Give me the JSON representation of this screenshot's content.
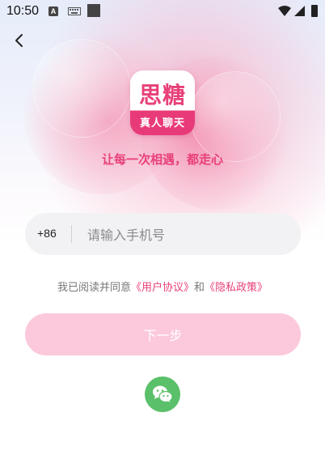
{
  "status_bar": {
    "time": "10:50",
    "a_badge": "A"
  },
  "logo": {
    "title": "思糖",
    "subtitle": "真人聊天"
  },
  "slogan": "让每一次相遇，都走心",
  "phone_form": {
    "country_code": "+86",
    "placeholder": "请输入手机号",
    "value": ""
  },
  "agreement": {
    "prefix": "我已阅读并同意",
    "user_agreement": "《用户协议》",
    "conjunction": "和",
    "privacy_policy": "《隐私政策》"
  },
  "next_button": "下一步",
  "icons": {
    "back": "back-arrow-icon",
    "wechat": "wechat-icon"
  },
  "colors": {
    "accent": "#e8407a",
    "button_disabled": "#fcc8dc",
    "wechat_green": "#5ac06a"
  }
}
